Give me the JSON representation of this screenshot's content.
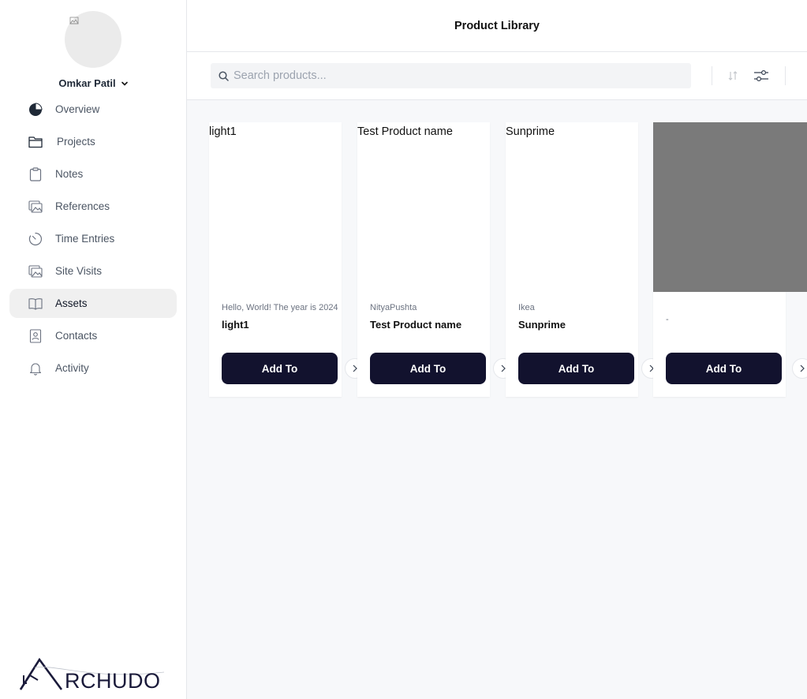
{
  "user": {
    "name": "Omkar Patil"
  },
  "sidebar": {
    "items": [
      {
        "label": "Overview",
        "icon": "pie-chart-icon",
        "active": false
      },
      {
        "label": "Projects",
        "icon": "folder-icon",
        "active": false
      },
      {
        "label": "Notes",
        "icon": "clipboard-icon",
        "active": false
      },
      {
        "label": "References",
        "icon": "images-icon",
        "active": false
      },
      {
        "label": "Time Entries",
        "icon": "timer-icon",
        "active": false
      },
      {
        "label": "Site Visits",
        "icon": "images-icon",
        "active": false
      },
      {
        "label": "Assets",
        "icon": "book-open-icon",
        "active": true
      },
      {
        "label": "Contacts",
        "icon": "contact-card-icon",
        "active": false
      },
      {
        "label": "Activity",
        "icon": "bell-icon",
        "active": false
      }
    ]
  },
  "logo": {
    "text": "RCHUDO"
  },
  "header": {
    "title": "Product Library"
  },
  "search": {
    "placeholder": "Search products..."
  },
  "products": [
    {
      "image_alt": "light1",
      "brand": "Hello, World! The year is 2024",
      "name": "light1",
      "button": "Add To"
    },
    {
      "image_alt": "Test Product name",
      "brand": "NityaPushta",
      "name": "Test Product name",
      "button": "Add To"
    },
    {
      "image_alt": "Sunprime",
      "brand": "Ikea",
      "name": "Sunprime",
      "button": "Add To"
    },
    {
      "image_alt": "",
      "brand": "-",
      "name": "",
      "button": "Add To"
    }
  ],
  "colors": {
    "button_bg": "#12122e",
    "active_nav_bg": "#f0f0f0",
    "placeholder_image": "#7a7a7a"
  }
}
